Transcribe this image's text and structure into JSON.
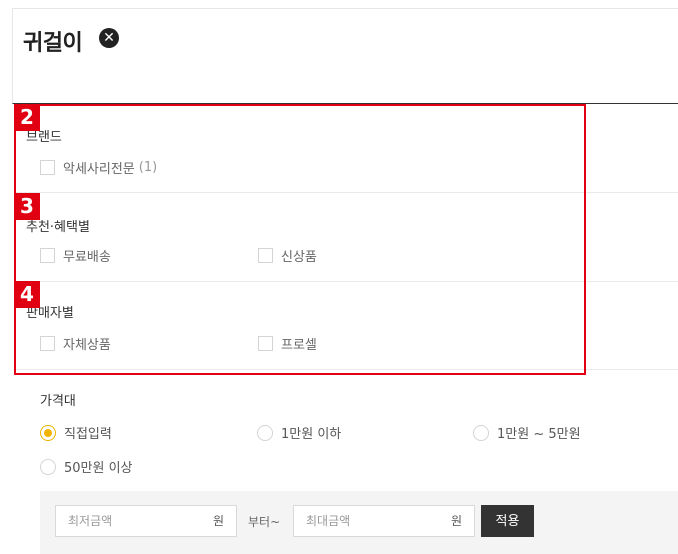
{
  "header": {
    "title": "귀걸이",
    "close_glyph": "✕"
  },
  "brand": {
    "title": "브랜드",
    "options": [
      {
        "label": "악세사리전문",
        "count": "(1)"
      }
    ]
  },
  "benefits": {
    "title": "추천·혜택별",
    "options": [
      {
        "label": "무료배송"
      },
      {
        "label": "신상품"
      }
    ]
  },
  "seller": {
    "title": "판매자별",
    "options": [
      {
        "label": "자체상품"
      },
      {
        "label": "프로셀"
      }
    ]
  },
  "price": {
    "title": "가격대",
    "options": [
      {
        "label": "직접입력",
        "selected": true
      },
      {
        "label": "1만원 이하",
        "selected": false
      },
      {
        "label": "1만원 ~ 5만원",
        "selected": false
      },
      {
        "label": "50만원 이상",
        "selected": false
      }
    ],
    "min_placeholder": "최저금액",
    "max_placeholder": "최대금액",
    "currency": "원",
    "between": "부터~",
    "apply_label": "적용"
  },
  "annotations": {
    "badges": [
      "2",
      "3",
      "4"
    ],
    "color": "#e00012"
  },
  "colors": {
    "accent_radio": "#f0b400",
    "apply_button": "#333333"
  }
}
